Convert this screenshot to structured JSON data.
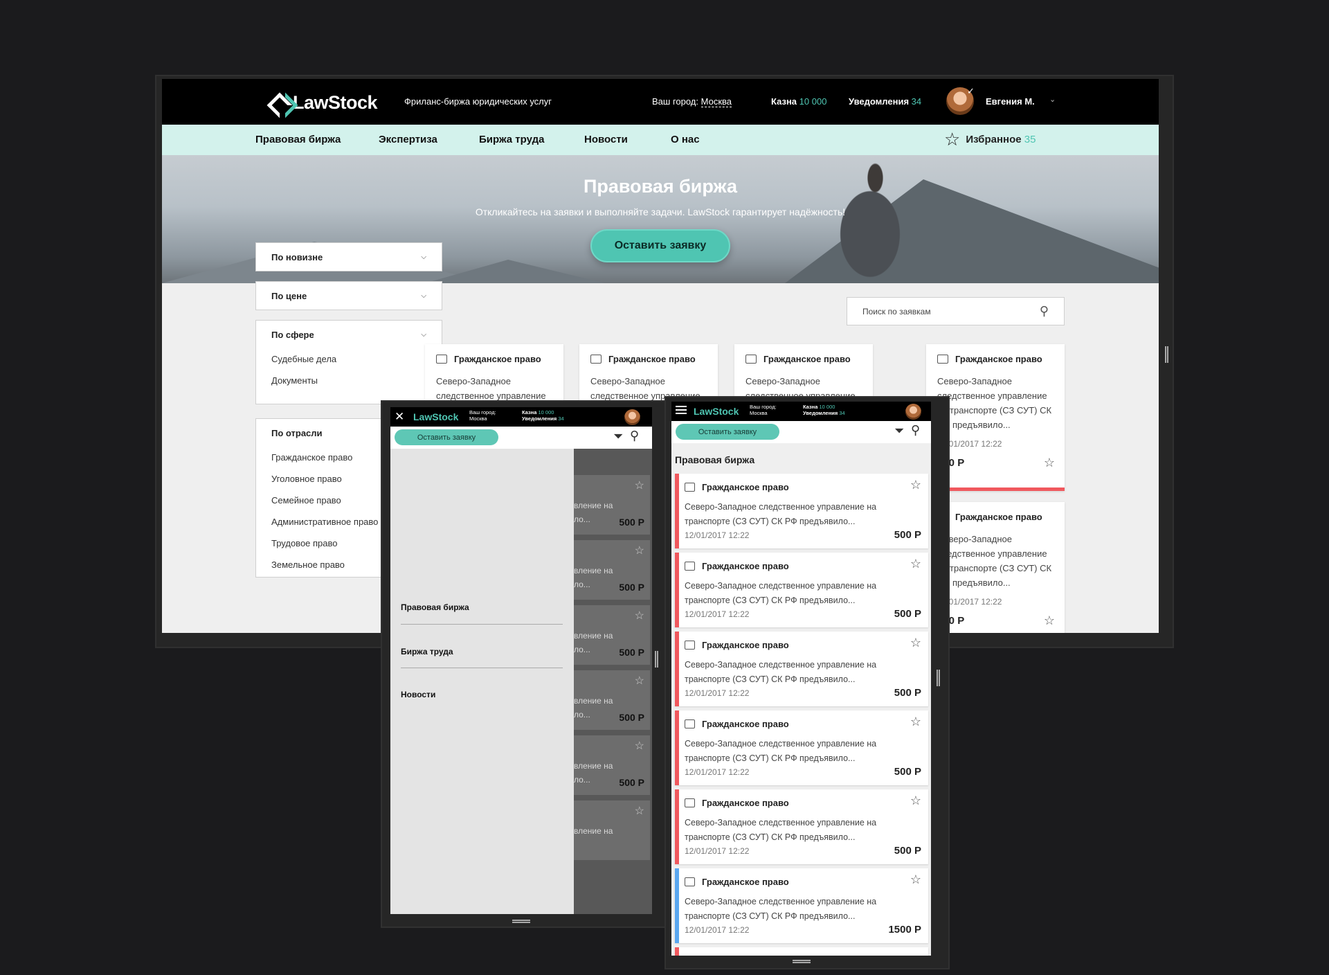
{
  "desktop": {
    "logo_text": "LawStock",
    "tagline": "Фриланс-биржа юридических услуг",
    "city_label": "Ваш город:",
    "city_value": "Москва",
    "kazna_label": "Казна",
    "kazna_value": "10 000",
    "notif_label": "Уведомления",
    "notif_value": "34",
    "user_name": "Евгения М.",
    "nav": [
      "Правовая биржа",
      "Экспертиза",
      "Биржа труда",
      "Новости",
      "О нас"
    ],
    "fav_label": "Избранное",
    "fav_count": "35",
    "hero_title": "Правовая биржа",
    "hero_sub": "Откликайтесь на заявки и выполняйте задачи. LawStock гарантирует надёжность!",
    "hero_button": "Оставить заявку",
    "sort_new": "По новизне",
    "sort_price": "По цене",
    "filter_sphere": "По сфере",
    "sphere_items": [
      "Судебные дела",
      "Документы"
    ],
    "filter_industry": "По отрасли",
    "industry_items": [
      "Гражданское право",
      "Уголовное право",
      "Семейное право",
      "Административное право",
      "Трудовое право",
      "Земельное право"
    ],
    "search_placeholder": "Поиск по заявкам",
    "cards": [
      {
        "title": "Гражданское право",
        "desc": "Северо-Западное следственное управление"
      },
      {
        "title": "Гражданское право",
        "desc": "Северо-Западное следственное управление"
      },
      {
        "title": "Гражданское право",
        "desc": "Северо-Западное следственное управление"
      },
      {
        "title": "Гражданское право",
        "desc": "Северо-Западное следственное управление на транспорте (СЗ СУТ) СК РФ предъявило...",
        "date": "12/01/2017 12:22",
        "price": "500 Р"
      },
      {
        "title": "Гражданское право",
        "desc": "Северо-Западное следственное управление на транспорте (СЗ СУТ) СК РФ предъявило...",
        "date": "12/01/2017 12:22",
        "price": "500 Р"
      }
    ]
  },
  "mobile_menu": {
    "logo_text": "LawStock",
    "city_label": "Ваш город:",
    "city_value": "Москва",
    "kazna_label": "Казна",
    "kazna_value": "10 000",
    "notif_label": "Уведомления",
    "notif_value": "34",
    "button": "Оставить заявку",
    "menu": [
      "Правовая биржа",
      "Биржа труда",
      "Новости"
    ],
    "behind_cards": [
      {
        "desc1": "вление на",
        "desc2": "ло...",
        "price": "500 Р"
      },
      {
        "desc1": "вление на",
        "desc2": "ло...",
        "price": "500 Р"
      },
      {
        "desc1": "вление на",
        "desc2": "ло...",
        "price": "500 Р"
      },
      {
        "desc1": "вление на",
        "desc2": "ло...",
        "price": "500 Р"
      },
      {
        "desc1": "вление на",
        "desc2": "ло...",
        "price": "500 Р"
      },
      {
        "desc1": "вление на",
        "desc2": "",
        "price": ""
      }
    ]
  },
  "mobile_list": {
    "logo_text": "LawStock",
    "city_label": "Ваш город:",
    "city_value": "Москва",
    "kazna_label": "Казна",
    "kazna_value": "10 000",
    "notif_label": "Уведомления",
    "notif_value": "34",
    "button": "Оставить заявку",
    "page_title": "Правовая биржа",
    "cards": [
      {
        "title": "Гражданское право",
        "desc": "Северо-Западное следственное управление на транспорте (СЗ СУТ) СК РФ предъявило...",
        "date": "12/01/2017 12:22",
        "price": "500 Р",
        "accent": "red"
      },
      {
        "title": "Гражданское право",
        "desc": "Северо-Западное следственное управление на транспорте (СЗ СУТ) СК РФ предъявило...",
        "date": "12/01/2017 12:22",
        "price": "500 Р",
        "accent": "red"
      },
      {
        "title": "Гражданское право",
        "desc": "Северо-Западное следственное управление на транспорте (СЗ СУТ) СК РФ предъявило...",
        "date": "12/01/2017 12:22",
        "price": "500 Р",
        "accent": "red"
      },
      {
        "title": "Гражданское право",
        "desc": "Северо-Западное следственное управление на транспорте (СЗ СУТ) СК РФ предъявило...",
        "date": "12/01/2017 12:22",
        "price": "500 Р",
        "accent": "red"
      },
      {
        "title": "Гражданское право",
        "desc": "Северо-Западное следственное управление на транспорте (СЗ СУТ) СК РФ предъявило...",
        "date": "12/01/2017 12:22",
        "price": "500 Р",
        "accent": "red"
      },
      {
        "title": "Гражданское право",
        "desc": "Северо-Западное следственное управление на транспорте (СЗ СУТ) СК РФ предъявило...",
        "date": "12/01/2017 12:22",
        "price": "1500 Р",
        "accent": "blue"
      }
    ]
  },
  "colors": {
    "brand": "#4fc5b2",
    "nav_bg": "#d3f2ec",
    "accent_red": "#f0585d",
    "accent_blue": "#5aa7f0"
  }
}
